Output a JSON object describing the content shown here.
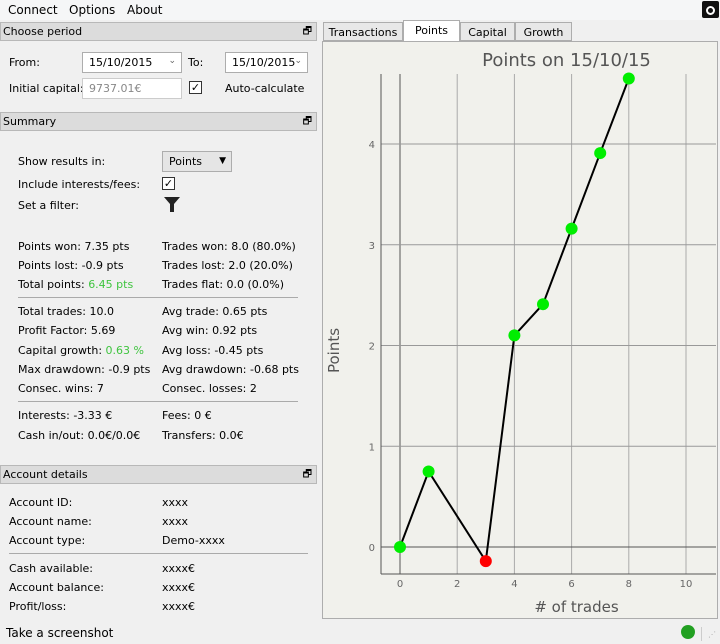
{
  "menu": {
    "items": [
      "Connect",
      "Options",
      "About"
    ]
  },
  "period": {
    "title": "Choose period",
    "from_label": "From:",
    "from_value": "15/10/2015",
    "to_label": "To:",
    "to_value": "15/10/2015",
    "capital_label": "Initial capital:",
    "capital_value": "9737.01€",
    "auto_label": "Auto-calculate",
    "auto_checked": true
  },
  "summary": {
    "title": "Summary",
    "show_label": "Show results in:",
    "show_value": "Points",
    "include_label": "Include interests/fees:",
    "include_checked": true,
    "filter_label": "Set a filter:",
    "rows1": [
      [
        "Points won: 7.35 pts",
        "Trades won: 8.0 (80.0%)"
      ],
      [
        "Points lost: -0.9 pts",
        "Trades lost: 2.0 (20.0%)"
      ]
    ],
    "total_points_label": "Total points: ",
    "total_points_value": "6.45 pts",
    "trades_flat": "Trades flat: 0.0 (0.0%)",
    "total_trades": "Total trades: 10.0",
    "avg_trade": "Avg trade: 0.65 pts",
    "profit_factor": "Profit Factor: 5.69",
    "avg_win": "Avg win: 0.92 pts",
    "growth_label": "Capital growth: ",
    "growth_value": "0.63 %",
    "avg_loss": "Avg loss: -0.45 pts",
    "max_dd": "Max drawdown: -0.9 pts",
    "avg_dd": "Avg drawdown: -0.68 pts",
    "consec_wins": "Consec. wins: 7",
    "consec_losses": "Consec. losses: 2",
    "interests": "Interests: -3.33 €",
    "fees": "Fees: 0 €",
    "cash_inout": "Cash in/out: 0.0€/0.0€",
    "transfers": "Transfers: 0.0€"
  },
  "account": {
    "title": "Account details",
    "rows": [
      [
        "Account ID:",
        "xxxx"
      ],
      [
        "Account name:",
        "xxxx"
      ],
      [
        "Account type:",
        "Demo-xxxx"
      ],
      [
        "Cash available:",
        "xxxx€"
      ],
      [
        "Account balance:",
        "xxxx€"
      ],
      [
        "Profit/loss:",
        "xxxx€"
      ]
    ]
  },
  "tabs": [
    "Transactions",
    "Points",
    "Capital",
    "Growth"
  ],
  "active_tab": "Points",
  "status": {
    "text": "Take a screenshot",
    "connection_color": "#22a022"
  },
  "chart_data": {
    "type": "line",
    "title": "Points on 15/10/15",
    "xlabel": "# of trades",
    "ylabel": "Points",
    "x": [
      0,
      1,
      3,
      4,
      5,
      6,
      7,
      8
    ],
    "y": [
      0,
      0.75,
      -0.14,
      2.1,
      2.41,
      3.16,
      3.91,
      4.65
    ],
    "point_colors": [
      "#00ee00",
      "#00ee00",
      "#ff0000",
      "#00ee00",
      "#00ee00",
      "#00ee00",
      "#00ee00",
      "#00ee00"
    ],
    "xticks": [
      0,
      2,
      4,
      6,
      8,
      10
    ],
    "yticks": [
      0,
      1,
      2,
      3,
      4
    ],
    "xlim": [
      -0.65,
      11.1
    ],
    "ylim": [
      -0.27,
      4.7
    ],
    "grid": true
  }
}
